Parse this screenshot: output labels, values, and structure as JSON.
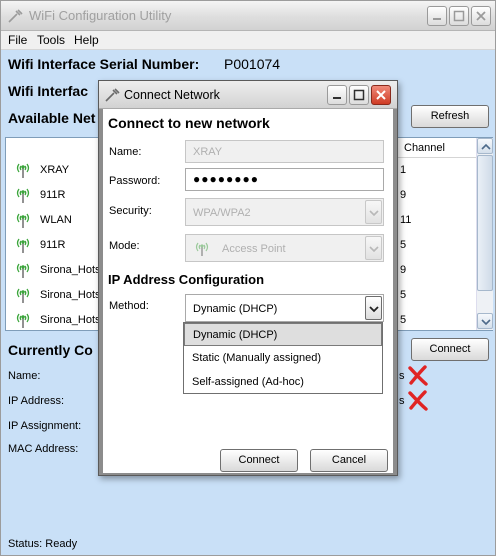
{
  "window": {
    "title": "WiFi Configuration Utility",
    "menu": [
      "File",
      "Tools",
      "Help"
    ],
    "serial_label": "Wifi Interface Serial Number:",
    "serial_value": "P001074",
    "interface_label": "Wifi Interfac",
    "available_label": "Available Net",
    "refresh_label": "Refresh",
    "channel_header": "Channel",
    "networks": [
      {
        "name": "XRAY",
        "channel": "1"
      },
      {
        "name": "911R",
        "channel": "9"
      },
      {
        "name": "WLAN",
        "channel": "11"
      },
      {
        "name": "911R",
        "channel": "5"
      },
      {
        "name": "Sirona_Hots",
        "channel": "9"
      },
      {
        "name": "Sirona_Hots",
        "channel": "5"
      },
      {
        "name": "Sirona_Hots",
        "channel": "5"
      }
    ],
    "currently_label": "Currently Co",
    "connect_label": "Connect",
    "info_labels": {
      "name": "Name:",
      "ip": "IP Address:",
      "ip_assignment": "IP Assignment:",
      "mac": "MAC Address:"
    },
    "info_trailing": {
      "name": "s",
      "ip": "s"
    },
    "status": "Status:  Ready"
  },
  "dialog": {
    "title": "Connect Network",
    "heading": "Connect to new network",
    "name_label": "Name:",
    "name_value": "XRAY",
    "password_label": "Password:",
    "password_value": "●●●●●●●●",
    "security_label": "Security:",
    "security_value": "WPA/WPA2",
    "mode_label": "Mode:",
    "mode_value": "Access Point",
    "ip_heading": "IP Address Configuration",
    "method_label": "Method:",
    "method_value": "Dynamic (DHCP)",
    "method_options": [
      "Dynamic (DHCP)",
      "Static (Manually assigned)",
      "Self-assigned (Ad-hoc)"
    ],
    "connect_label": "Connect",
    "cancel_label": "Cancel"
  },
  "colors": {
    "accent_red": "#e02424",
    "window_bg": "#c9e0f7",
    "signal_green": "#3aa53a"
  },
  "icons": [
    "wrench-icon",
    "minimize-icon",
    "maximize-icon",
    "close-icon",
    "signal-icon",
    "red-x-icon",
    "chevron-down-icon",
    "chevron-up-icon"
  ]
}
